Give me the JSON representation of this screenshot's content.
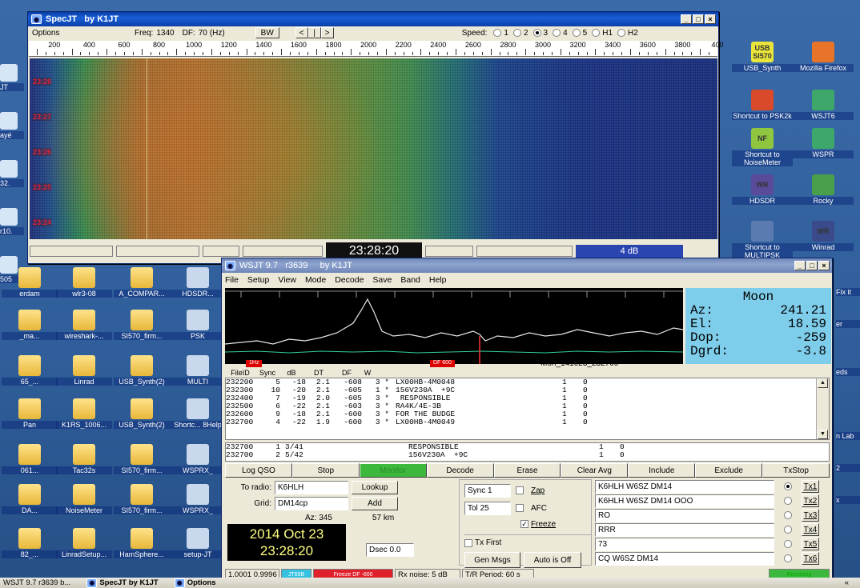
{
  "desktop": {
    "right_icons": [
      {
        "label": "USB_Synth",
        "badge": "USB SI570",
        "color": "#e9e53a"
      },
      {
        "label": "Mozilla Firefox",
        "color": "#e8742a"
      },
      {
        "label": "Shortcut to PSK2k",
        "color": "#d94a2a"
      },
      {
        "label": "WSJT6",
        "color": "#3ea86a"
      },
      {
        "label": "Shortcut to NoiseMeter",
        "badge": "NF",
        "color": "#8ec63f"
      },
      {
        "label": "WSPR",
        "color": "#3ea86a"
      },
      {
        "label": "HDSDR",
        "badge": "WR",
        "color": "#5a4a9a"
      },
      {
        "label": "Rocky",
        "color": "#4aa04a"
      },
      {
        "label": "Shortcut to MULTIPSK",
        "color": "#5a7ab0"
      },
      {
        "label": "Winrad",
        "badge": "WR",
        "color": "#3a4a8a"
      }
    ],
    "left_icons": [
      {
        "label": "erdam"
      },
      {
        "label": "wlr3-08"
      },
      {
        "label": "A_COMPAR..."
      },
      {
        "label": "HDSDR..."
      },
      {
        "label": "_ma..."
      },
      {
        "label": "wireshark-..."
      },
      {
        "label": "SI570_firm..."
      },
      {
        "label": "PSK"
      },
      {
        "label": "65_..."
      },
      {
        "label": "Linrad"
      },
      {
        "label": "USB_Synth(2)"
      },
      {
        "label": "MULTI"
      },
      {
        "label": "Pan"
      },
      {
        "label": "K1RS_1006..."
      },
      {
        "label": "USB_Synth(2)"
      },
      {
        "label": "Shortc... 8Help"
      },
      {
        "label": "061..."
      },
      {
        "label": "Tac32s"
      },
      {
        "label": "SI570_firm..."
      },
      {
        "label": "WSPRX_"
      },
      {
        "label": "DA..."
      },
      {
        "label": "NoiseMeter"
      },
      {
        "label": "SI570_firm..."
      },
      {
        "label": "WSPRX_"
      },
      {
        "label": "82_..."
      },
      {
        "label": "LinradSetup..."
      },
      {
        "label": "HamSphere..."
      },
      {
        "label": "setup-JT"
      }
    ],
    "right_edge_labels": [
      "Fix it",
      "er",
      "eds",
      "n Lab",
      "2",
      "x"
    ],
    "left_edge_labels": [
      "JT",
      "ayé",
      "32.",
      "r10.",
      "505"
    ]
  },
  "spec": {
    "title": "SpecJT   by K1JT",
    "menu_options": "Options",
    "freq_label": "Freq:",
    "freq": "1340",
    "df_label": "DF:",
    "df": "70",
    "df_unit": "(Hz)",
    "bw_button": "BW",
    "nav_buttons": [
      "<",
      "|",
      ">"
    ],
    "speed_label": "Speed:",
    "speeds": [
      {
        "label": "1",
        "on": false
      },
      {
        "label": "2",
        "on": false
      },
      {
        "label": "3",
        "on": true
      },
      {
        "label": "4",
        "on": false
      },
      {
        "label": "5",
        "on": false
      },
      {
        "label": "H1",
        "on": false
      },
      {
        "label": "H2",
        "on": false
      }
    ],
    "ruler_labels": [
      "200",
      "400",
      "600",
      "800",
      "1000",
      "1200",
      "1400",
      "1600",
      "1800",
      "2000",
      "2200",
      "2400",
      "2600",
      "2800",
      "3000",
      "3200",
      "3400",
      "3600",
      "3800",
      "400"
    ],
    "time_tags": [
      "23:28",
      "23:27",
      "23:26",
      "23:25",
      "23:24"
    ],
    "clock": "23:28:20",
    "gain": "4 dB"
  },
  "wsjt": {
    "title": "WSJT 9.7   r3639     by K1JT",
    "menu": [
      "File",
      "Setup",
      "View",
      "Mode",
      "Decode",
      "Save",
      "Band",
      "Help"
    ],
    "moon": {
      "title": "Moon",
      "rows": [
        {
          "k": "Az:",
          "v": "241.21"
        },
        {
          "k": "El:",
          "v": "18.59"
        },
        {
          "k": "Dop:",
          "v": "-259"
        },
        {
          "k": "Dgrd:",
          "v": "-3.8"
        }
      ]
    },
    "file_label": "Mon_141023_232700",
    "headers": [
      "FileID",
      "Sync",
      "dB",
      "DT",
      "DF",
      "W"
    ],
    "decodes": [
      {
        "id": "232200",
        "sync": "5",
        "db": "-18",
        "dt": "2.1",
        "df": "-608",
        "w": "3 *",
        "msg": "LX00HB-4M0048",
        "n1": "1",
        "n2": "0"
      },
      {
        "id": "232300",
        "sync": "10",
        "db": "-20",
        "dt": "2.1",
        "df": "-605",
        "w": "1 *",
        "msg": "156V230A  +9C",
        "n1": "1",
        "n2": "0"
      },
      {
        "id": "232400",
        "sync": "7",
        "db": "-19",
        "dt": "2.0",
        "df": "-605",
        "w": "3 *",
        "msg": " RESPONSIBLE",
        "n1": "1",
        "n2": "0"
      },
      {
        "id": "232500",
        "sync": "6",
        "db": "-22",
        "dt": "2.1",
        "df": "-603",
        "w": "3 *",
        "msg": "RA4K/4E-3B",
        "n1": "1",
        "n2": "0"
      },
      {
        "id": "232600",
        "sync": "9",
        "db": "-18",
        "dt": "2.1",
        "df": "-600",
        "w": "3 *",
        "msg": "FOR THE BUDGE",
        "n1": "1",
        "n2": "0"
      },
      {
        "id": "232700",
        "sync": "4",
        "db": "-22",
        "dt": "1.9",
        "df": "-600",
        "w": "3 *",
        "msg": "LX00HB-4M0049",
        "n1": "1",
        "n2": "0"
      }
    ],
    "avg": [
      {
        "id": "232700",
        "sync": "1",
        "val": "3/41",
        "msg": "RESPONSIBLE",
        "n1": "1",
        "n2": "0"
      },
      {
        "id": "232700",
        "sync": "2",
        "val": "5/42",
        "msg": "156V230A  +9C",
        "n1": "1",
        "n2": "0"
      }
    ],
    "commands": [
      "Log QSO",
      "Stop",
      "Monitor",
      "Decode",
      "Erase",
      "Clear Avg",
      "Include",
      "Exclude",
      "TxStop"
    ],
    "to_radio_label": "To radio:",
    "to_radio": "K6HLH",
    "lookup": "Lookup",
    "grid_label": "Grid:",
    "grid": "DM14cp",
    "add": "Add",
    "az": "Az: 345",
    "km": "57 km",
    "date": "2014 Oct 23",
    "utc": "23:28:20",
    "dsec": "Dsec  0.0",
    "sync_label": "Sync",
    "sync_val": "1",
    "tol_label": "Tol",
    "tol_val": "25",
    "zap": "Zap",
    "afc": "AFC",
    "freeze": "Freeze",
    "txfirst": "Tx First",
    "genmsgs": "Gen Msgs",
    "autooff": "Auto is Off",
    "tx": [
      {
        "msg": "K6HLH W6SZ DM14",
        "label": "Tx1",
        "on": true
      },
      {
        "msg": "K6HLH W6SZ DM14 OOO",
        "label": "Tx2",
        "on": false
      },
      {
        "msg": "RO",
        "label": "Tx3",
        "on": false
      },
      {
        "msg": "RRR",
        "label": "Tx4",
        "on": false
      },
      {
        "msg": "73",
        "label": "Tx5",
        "on": false
      },
      {
        "msg": "CQ W6SZ DM14",
        "label": "Tx6",
        "on": false
      }
    ],
    "status": {
      "ratio": "1.0001 0.9996",
      "mode": "JT65B",
      "freeze": "Freeze DF -600",
      "noise": "Rx noise:  5 dB",
      "period": "T/R Period: 60 s",
      "rx": "Receiving"
    },
    "tags": [
      "1Hz",
      "DF 600"
    ]
  },
  "taskbar": {
    "items": [
      "WSJT 9.7  r3639  b...",
      "SpecJT  by K1JT",
      "Options"
    ],
    "tray": "«"
  },
  "colors": {
    "moon": "#7ecdea",
    "monitor": "#3cb93c",
    "receiving": "#3cb93c",
    "jt65": "#35c2e0",
    "freeze": "#e0202a"
  }
}
